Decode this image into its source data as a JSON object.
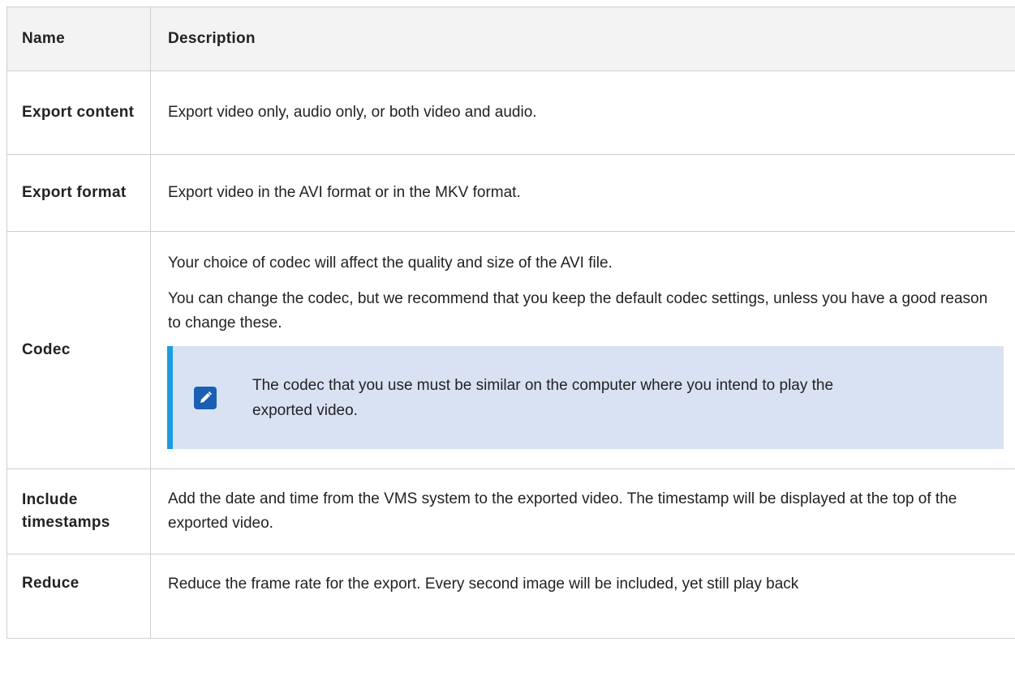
{
  "table": {
    "headers": {
      "name": "Name",
      "description": "Description"
    },
    "rows": [
      {
        "name": "Export content",
        "description": "Export video only, audio only, or both video and audio."
      },
      {
        "name": "Export format",
        "description": "Export video in the AVI format or in the MKV format."
      },
      {
        "name": "Codec",
        "paragraphs": [
          "Your choice of codec will affect the quality and size of the AVI file.",
          "You can change the codec, but we recommend that you keep the default codec settings, unless you have a good reason to change these."
        ],
        "note": {
          "icon": "pencil-note-icon",
          "text": "The codec that you use must be similar on the computer where you intend to play the exported video."
        }
      },
      {
        "name": "Include timestamps",
        "description": "Add the date and time from the VMS system to the exported video. The timestamp will be displayed at the top of the exported video."
      },
      {
        "name": "Reduce",
        "description": "Reduce the frame rate for the export. Every second image will be included, yet still play back"
      }
    ]
  },
  "colors": {
    "header_bg": "#f3f3f3",
    "note_bg": "#d9e2f3",
    "note_border": "#1a9de0",
    "icon": "#1a5fb4"
  }
}
